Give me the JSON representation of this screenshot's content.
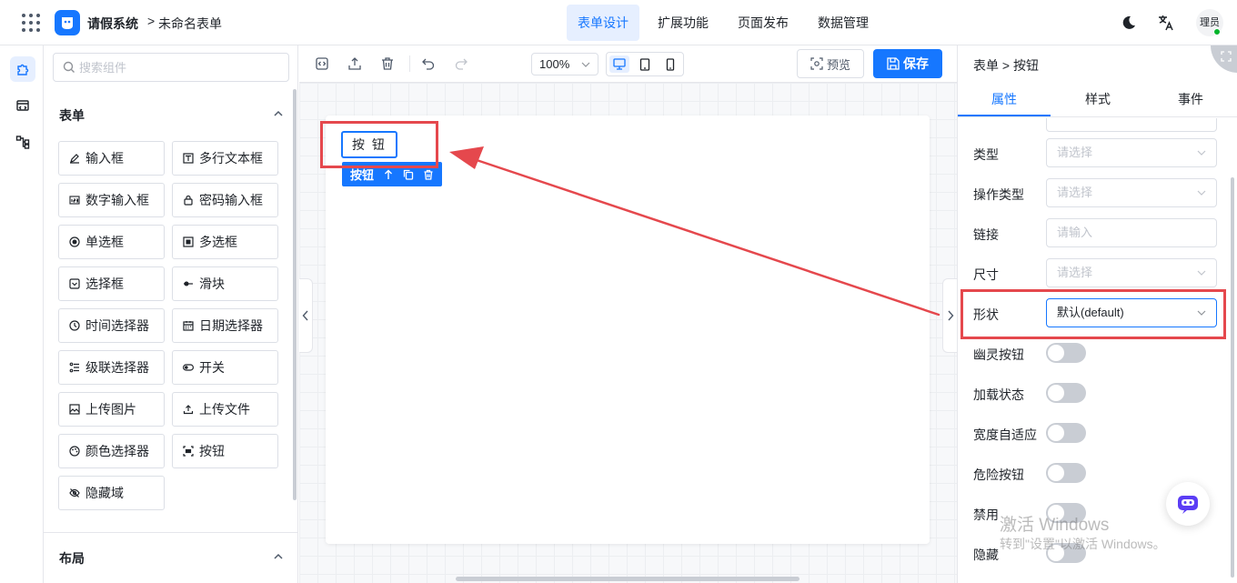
{
  "header": {
    "app_title": "请假系统",
    "breadcrumb_separator": ">",
    "form_name": "未命名表单",
    "tabs": [
      {
        "label": "表单设计",
        "active": true
      },
      {
        "label": "扩展功能",
        "active": false
      },
      {
        "label": "页面发布",
        "active": false
      },
      {
        "label": "数据管理",
        "active": false
      }
    ],
    "avatar_text": "理员",
    "icons": [
      "apps-grid-icon",
      "logo-icon",
      "moon-icon",
      "translate-icon"
    ]
  },
  "rail": {
    "icons": [
      "puzzle-icon",
      "code-block-icon",
      "flow-icon"
    ]
  },
  "components": {
    "search_placeholder": "搜索组件",
    "groups": [
      {
        "title": "表单",
        "items": [
          {
            "label": "输入框",
            "icon": "pen-icon"
          },
          {
            "label": "多行文本框",
            "icon": "text-area-icon"
          },
          {
            "label": "数字输入框",
            "icon": "number-icon"
          },
          {
            "label": "密码输入框",
            "icon": "lock-icon"
          },
          {
            "label": "单选框",
            "icon": "radio-icon"
          },
          {
            "label": "多选框",
            "icon": "checkbox-icon"
          },
          {
            "label": "选择框",
            "icon": "select-icon"
          },
          {
            "label": "滑块",
            "icon": "slider-icon"
          },
          {
            "label": "时间选择器",
            "icon": "clock-icon"
          },
          {
            "label": "日期选择器",
            "icon": "calendar-icon"
          },
          {
            "label": "级联选择器",
            "icon": "cascader-icon"
          },
          {
            "label": "开关",
            "icon": "switch-icon"
          },
          {
            "label": "上传图片",
            "icon": "image-icon"
          },
          {
            "label": "上传文件",
            "icon": "upload-icon"
          },
          {
            "label": "颜色选择器",
            "icon": "palette-icon"
          },
          {
            "label": "按钮",
            "icon": "button-icon"
          },
          {
            "label": "隐藏域",
            "icon": "eye-off-icon"
          }
        ]
      },
      {
        "title": "布局",
        "items": []
      }
    ]
  },
  "toolbar": {
    "zoom": "100%",
    "preview_label": "预览",
    "save_label": "保存",
    "active_device": "desktop"
  },
  "canvas": {
    "button_text": "按 钮",
    "selection_label": "按钮"
  },
  "properties": {
    "breadcrumb": "表单 > 按钮",
    "tabs": [
      {
        "label": "属性",
        "active": true
      },
      {
        "label": "样式",
        "active": false
      },
      {
        "label": "事件",
        "active": false
      }
    ],
    "fields": [
      {
        "label": "类型",
        "placeholder": "请选择",
        "kind": "select"
      },
      {
        "label": "操作类型",
        "placeholder": "请选择",
        "kind": "select"
      },
      {
        "label": "链接",
        "placeholder": "请输入",
        "kind": "input"
      },
      {
        "label": "尺寸",
        "placeholder": "请选择",
        "kind": "select"
      },
      {
        "label": "形状",
        "value": "默认(default)",
        "kind": "select"
      }
    ],
    "toggles": [
      {
        "label": "幽灵按钮",
        "on": false
      },
      {
        "label": "加载状态",
        "on": false
      },
      {
        "label": "宽度自适应",
        "on": false
      },
      {
        "label": "危险按钮",
        "on": false
      },
      {
        "label": "禁用",
        "on": false
      },
      {
        "label": "隐藏",
        "on": false
      }
    ]
  },
  "watermark": {
    "line1": "激活 Windows",
    "line2": "转到\"设置\"以激活 Windows。"
  },
  "colors": {
    "primary": "#1677ff",
    "annotation": "#e5484d"
  }
}
